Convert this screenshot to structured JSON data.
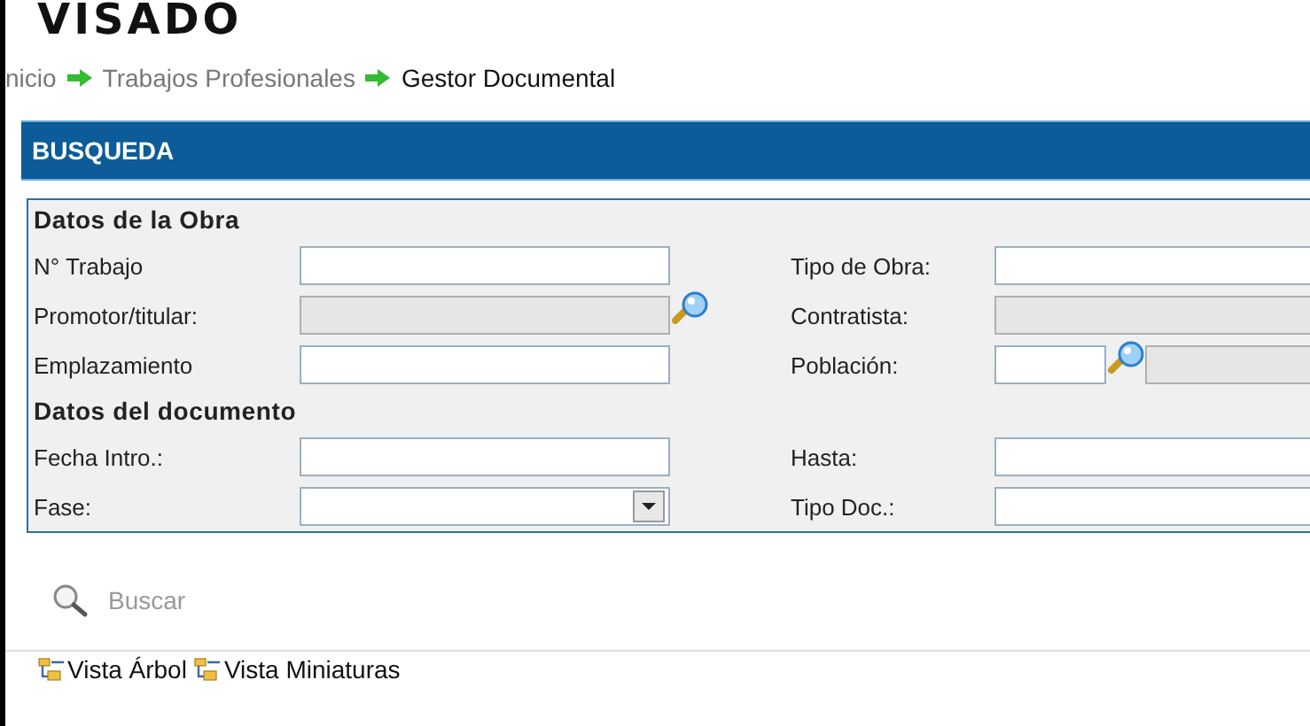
{
  "logo": "VISADO",
  "breadcrumb": [
    {
      "label": "nicio",
      "current": false
    },
    {
      "label": "Trabajos Profesionales",
      "current": false
    },
    {
      "label": "Gestor Documental",
      "current": true
    }
  ],
  "panel_title": "BUSQUEDA",
  "sections": [
    {
      "title": "Datos de la Obra",
      "rows": [
        [
          {
            "label": "N° Trabajo",
            "kind": "text",
            "disabled": false,
            "lookup": false
          },
          {
            "label": "Tipo de Obra:",
            "kind": "text",
            "disabled": false,
            "lookup": false
          }
        ],
        [
          {
            "label": "Promotor/titular:",
            "kind": "text",
            "disabled": true,
            "lookup": true
          },
          {
            "label": "Contratista:",
            "kind": "text",
            "disabled": true,
            "lookup": false
          }
        ],
        [
          {
            "label": "Emplazamiento",
            "kind": "text",
            "disabled": false,
            "lookup": false
          },
          {
            "label": "Población:",
            "kind": "pair",
            "disabled": false,
            "lookup": true
          }
        ]
      ]
    },
    {
      "title": "Datos del documento",
      "rows": [
        [
          {
            "label": "Fecha Intro.:",
            "kind": "text",
            "disabled": false,
            "lookup": false
          },
          {
            "label": "Hasta:",
            "kind": "text",
            "disabled": false,
            "lookup": false
          }
        ],
        [
          {
            "label": "Fase:",
            "kind": "select",
            "disabled": false,
            "lookup": false
          },
          {
            "label": "Tipo Doc.:",
            "kind": "text",
            "disabled": false,
            "lookup": false
          }
        ]
      ]
    }
  ],
  "search_button": "Buscar",
  "views": [
    "Vista Árbol",
    "Vista Miniaturas"
  ]
}
